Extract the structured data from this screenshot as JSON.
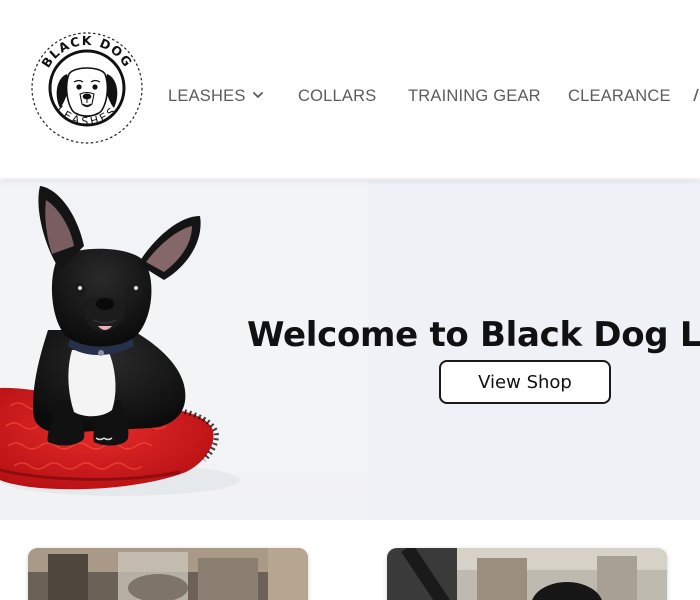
{
  "site": {
    "logo": {
      "alt": "Black Dog Leashes logo",
      "top_text": "BLACK DOG",
      "bottom_text": "LEASHES"
    }
  },
  "nav": {
    "items": [
      {
        "label": "LEASHES",
        "has_dropdown": true
      },
      {
        "label": "COLLARS",
        "has_dropdown": false
      },
      {
        "label": "TRAINING GEAR",
        "has_dropdown": false
      },
      {
        "label": "CLEARANCE",
        "has_dropdown": false
      }
    ]
  },
  "hero": {
    "title": "Welcome to Black Dog Leashes",
    "button_label": "View Shop"
  },
  "products": {
    "cards": [
      {
        "image": "dog-photo-outdoor-1"
      },
      {
        "image": "dog-photo-outdoor-2"
      }
    ]
  },
  "colors": {
    "nav_text": "#5c5c5c",
    "hero_bg": "#eef2f7",
    "title_text": "#111111",
    "button_border": "#1a1a1a",
    "cushion_red": "#d81b1b"
  }
}
